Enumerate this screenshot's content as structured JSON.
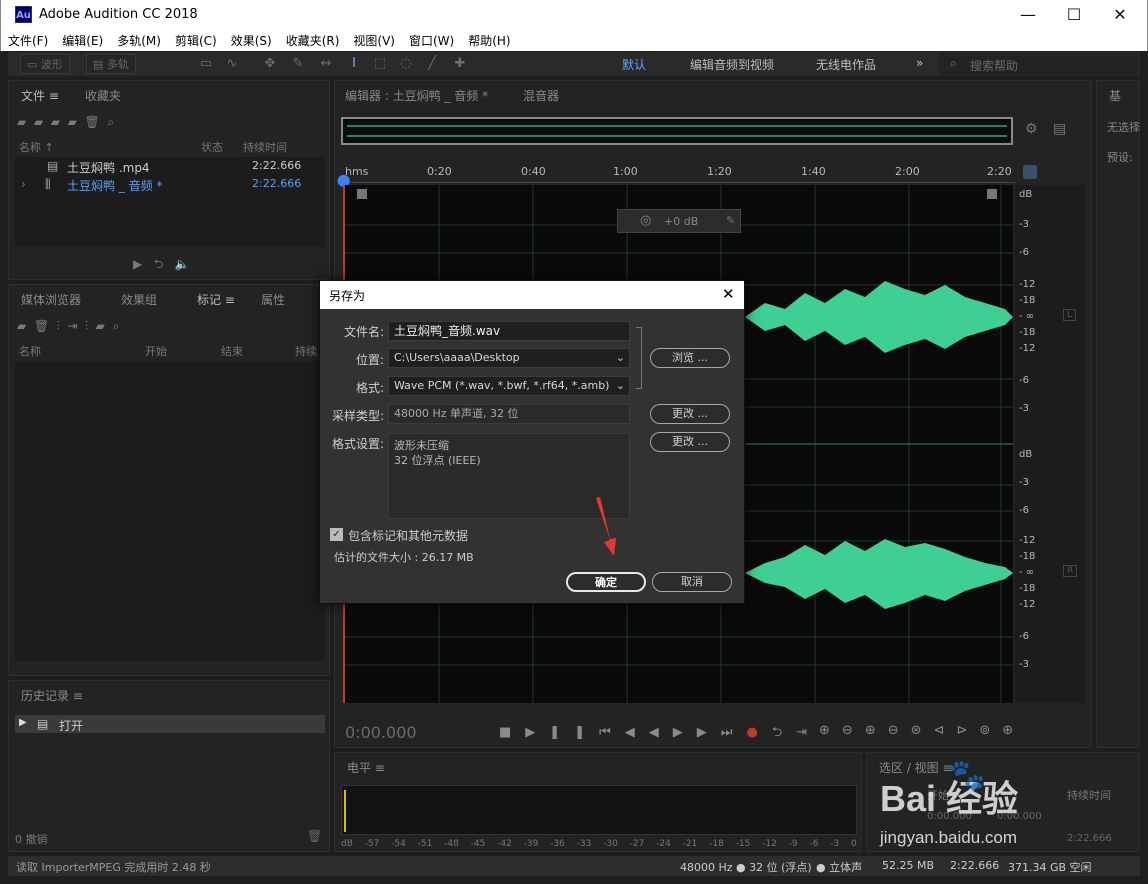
{
  "window": {
    "title": "Adobe Audition CC 2018",
    "logo": "Au",
    "minimize": "—",
    "maximize": "☐",
    "close": "✕"
  },
  "menu": [
    "文件(F)",
    "编辑(E)",
    "多轨(M)",
    "剪辑(C)",
    "效果(S)",
    "收藏夹(R)",
    "视图(V)",
    "窗口(W)",
    "帮助(H)"
  ],
  "toolbar": {
    "waveform": "波形",
    "multitrack": "多轨",
    "workspaces": [
      "默认",
      "编辑音频到视频",
      "无线电作品"
    ],
    "more": "»",
    "search_placeholder": "搜索帮助"
  },
  "files_panel": {
    "tabs": [
      "文件",
      "收藏夹"
    ],
    "columns": [
      "名称",
      "状态",
      "持续时间"
    ],
    "rows": [
      {
        "name": "土豆焖鸭 .mp4",
        "duration": "2:22.666"
      },
      {
        "name": "土豆焖鸭 _ 音频 *",
        "duration": "2:22.666"
      }
    ]
  },
  "media_panel": {
    "tabs": [
      "媒体浏览器",
      "效果组",
      "标记",
      "属性"
    ],
    "columns": [
      "名称",
      "开始",
      "结束",
      "持续"
    ]
  },
  "history_panel": {
    "title": "历史记录",
    "item": "打开",
    "undo_count": "0 撤销"
  },
  "editor": {
    "tab": "编辑器 : 土豆焖鸭 _ 音频 *",
    "mixer_tab": "混音器",
    "timeline_ticks": [
      "hms",
      "0:20",
      "0:40",
      "1:00",
      "1:20",
      "1:40",
      "2:00",
      "2:20"
    ],
    "hud_gain": "+0 dB",
    "db_scale_top": [
      "dB",
      "-3",
      "-6",
      "-12",
      "-18",
      "- ∞",
      "-18",
      "-12",
      "-6",
      "-3"
    ],
    "db_scale_bottom": [
      "dB",
      "-3",
      "-6",
      "-12",
      "-18",
      "- ∞",
      "-18",
      "-12",
      "-6",
      "-3"
    ],
    "channel_left": "L",
    "channel_right": "R",
    "time": "0:00.000"
  },
  "level_panel": {
    "title": "电平",
    "scale": [
      "dB",
      "-57",
      "-54",
      "-51",
      "-48",
      "-45",
      "-42",
      "-39",
      "-36",
      "-33",
      "-30",
      "-27",
      "-24",
      "-21",
      "-18",
      "-15",
      "-12",
      "-9",
      "-6",
      "-3",
      "0"
    ]
  },
  "selection_panel": {
    "title": "选区 / 视图",
    "start": "开始",
    "duration": "持续时间",
    "values": [
      "0:00.000",
      "0:00.000",
      "2:22.666"
    ]
  },
  "right_panel": {
    "title": "基",
    "none_selected": "无选择",
    "preset": "预设:"
  },
  "dialog": {
    "title": "另存为",
    "filename_label": "文件名:",
    "filename": "土豆焖鸭_音频.wav",
    "location_label": "位置:",
    "location": "C:\\Users\\aaaa\\Desktop",
    "browse": "浏览 ...",
    "format_label": "格式:",
    "format": "Wave PCM (*.wav, *.bwf, *.rf64, *.amb)",
    "sample_label": "采样类型:",
    "sample": "48000 Hz 单声道, 32 位",
    "change1": "更改 ...",
    "format_settings_label": "格式设置:",
    "format_settings": [
      "波形未压缩",
      "32 位浮点 (IEEE)"
    ],
    "change2": "更改 ...",
    "include_markers": "包含标记和其他元数据",
    "include_checked": true,
    "est_size": "估计的文件大小 : 26.17 MB",
    "ok": "确定",
    "cancel": "取消"
  },
  "status": {
    "left": "读取 ImporterMPEG 完成用时 2.48 秒",
    "sample": "48000 Hz ● 32 位 (浮点)",
    "channels": "● 立体声",
    "size": "52.25 MB",
    "duration": "2:22.666",
    "free": "371.34 GB 空闲"
  },
  "watermark": {
    "text": "Bai  经验",
    "url": "jingyan.baidu.com"
  }
}
